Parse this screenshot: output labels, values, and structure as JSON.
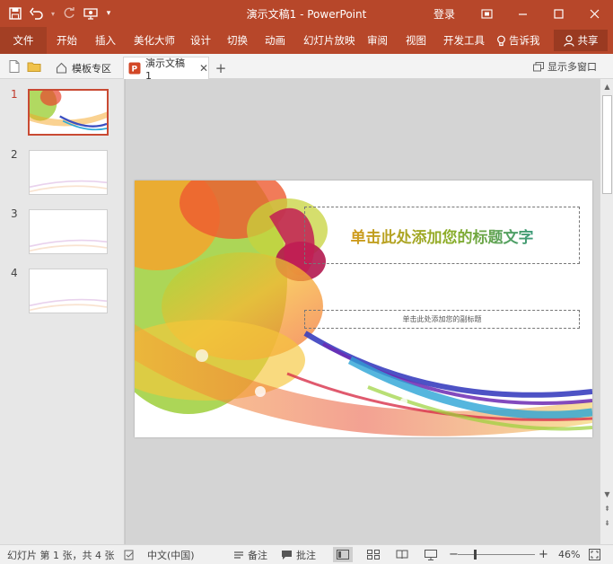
{
  "window": {
    "title": "演示文稿1 - PowerPoint",
    "login": "登录"
  },
  "ribbon": {
    "file": "文件",
    "tabs": [
      "开始",
      "插入",
      "美化大师",
      "设计",
      "切换",
      "动画",
      "幻灯片放映",
      "审阅",
      "视图",
      "开发工具"
    ],
    "tell_me": "告诉我",
    "share": "共享"
  },
  "docbar": {
    "template_tab": "模板专区",
    "doc_tab": "演示文稿1",
    "multi_window": "显示多窗口"
  },
  "thumbnails": [
    "1",
    "2",
    "3",
    "4"
  ],
  "slide": {
    "title_placeholder": "单击此处添加您的标题文字",
    "subtitle_placeholder": "单击此处添加您的副标题"
  },
  "status": {
    "slide_info": "幻灯片 第 1 张，共 4 张",
    "language": "中文(中国)",
    "notes": "备注",
    "comments": "批注",
    "zoom_percent": "46%",
    "zoom_value": 46
  },
  "colors": {
    "brand": "#b7472a",
    "selected_thumb_border": "#c94a33"
  },
  "icons": [
    "save-icon",
    "undo-icon",
    "redo-icon",
    "customize-icon",
    "restore-icon",
    "minimize-icon",
    "maximize-icon",
    "close-icon",
    "lightbulb-icon",
    "person-icon",
    "new-doc-icon",
    "folder-icon",
    "home-icon",
    "pptx-icon",
    "plus-icon",
    "notes-icon",
    "comment-icon",
    "spellcheck-icon",
    "fit-window-icon"
  ]
}
